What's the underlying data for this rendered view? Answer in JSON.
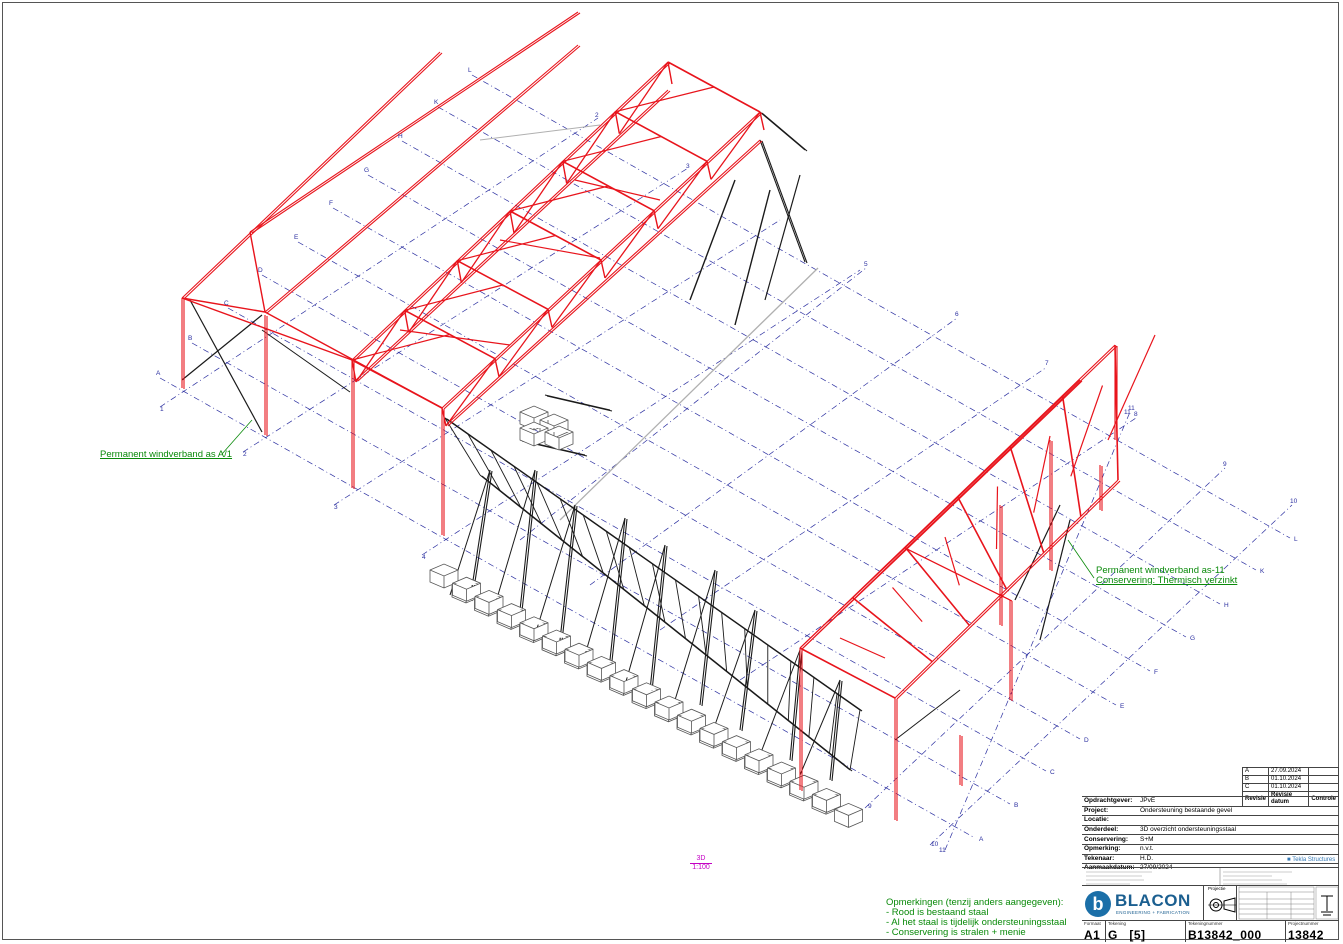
{
  "drawing": {
    "grid_letters": [
      "A",
      "B",
      "C",
      "D",
      "E",
      "F",
      "G",
      "H",
      "K",
      "L"
    ],
    "grid_numbers_left": [
      "1",
      "2",
      "3",
      "4"
    ],
    "grid_numbers_right": [
      "5",
      "6",
      "7",
      "8",
      "9",
      "10",
      "11"
    ],
    "colors": {
      "existing_steel": "#e8141c",
      "temporary_steel": "#1a1a1a",
      "grid": "#2b2fa0",
      "annotation": "#0a8a0a",
      "scale": "#c400c4"
    }
  },
  "annotations": {
    "wind_a1": "Permanent windverband as A/1",
    "wind_11_line1": "Permanent windverband as-11",
    "wind_11_line2": "Conservering: Thermisch verzinkt"
  },
  "scale": {
    "label": "3D",
    "value": "1:100"
  },
  "remarks": {
    "title": "Opmerkingen (tenzij anders aangegeven):",
    "items": [
      "- Rood is bestaand staal",
      "- Al het staal is tijdelijk ondersteuningsstaal",
      "- Conservering is stralen + menie"
    ]
  },
  "revisions": {
    "rows": [
      {
        "rev": "A",
        "date": "27.09.2024",
        "check": ""
      },
      {
        "rev": "B",
        "date": "01.10.2024",
        "check": ""
      },
      {
        "rev": "C",
        "date": "01.10.2024",
        "check": ""
      }
    ],
    "headers": {
      "rev": "Revisie",
      "date": "Revisie datum",
      "check": "Controle"
    }
  },
  "title_block": {
    "rows": [
      {
        "key": "Opdrachtgever:",
        "value": "JPvE"
      },
      {
        "key": "Project:",
        "value": "Ondersteuning bestaande gevel"
      },
      {
        "key": "Locatie:",
        "value": ""
      },
      {
        "key": "Onderdeel:",
        "value": "3D overzicht ondersteuningsstaal"
      },
      {
        "key": "Conservering:",
        "value": "S+M"
      },
      {
        "key": "Opmerking:",
        "value": "n.v.t."
      },
      {
        "key": "Tekenaar:",
        "value": "H.D."
      },
      {
        "key": "Aanmaakdatum:",
        "value": "27/09/2024"
      }
    ],
    "software": "Tekla Structures",
    "company": {
      "initial": "b",
      "name": "BLACON",
      "tagline": "ENGINEERING + FABRICATION"
    },
    "projection_label": "Projectie",
    "cells": [
      {
        "label": "Formaat",
        "value": "A1"
      },
      {
        "label": "Tekening",
        "value": "G   [5]"
      },
      {
        "label": "Tekeningnummer",
        "value": "B13842_000"
      },
      {
        "label": "Projectnummer",
        "value": "13842"
      }
    ]
  }
}
